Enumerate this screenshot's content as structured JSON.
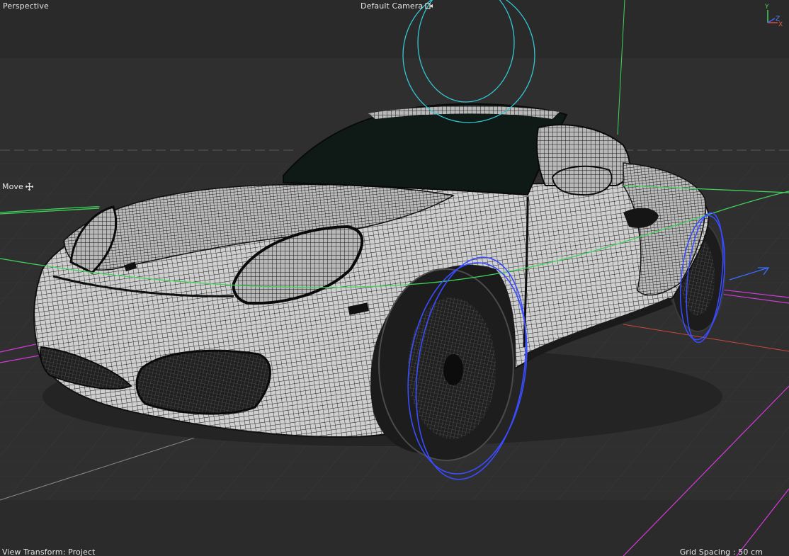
{
  "viewport": {
    "view_name": "Perspective",
    "camera_name": "Default Camera",
    "active_tool": "Move",
    "view_transform": "View Transform: Project",
    "grid_spacing": "Grid Spacing : 50 cm"
  },
  "axis_gizmo": {
    "y_label": "Y",
    "z_label": "Z",
    "x_label": "X"
  },
  "icons": {
    "camera": "camera-link-icon",
    "move": "move-cross-icon"
  },
  "colors": {
    "background": "#2f2f2f",
    "horizon_band": "#3a3a3a",
    "selection_cyan": "#33c7d4",
    "wheel_blue": "#3a4cff",
    "y_axis_green": "#3fd35a",
    "magenta_grid": "#d43ad8",
    "x_axis_red": "#c94a3a",
    "mesh_light": "#d6d6d6",
    "mesh_dark": "#1e1e1e"
  }
}
